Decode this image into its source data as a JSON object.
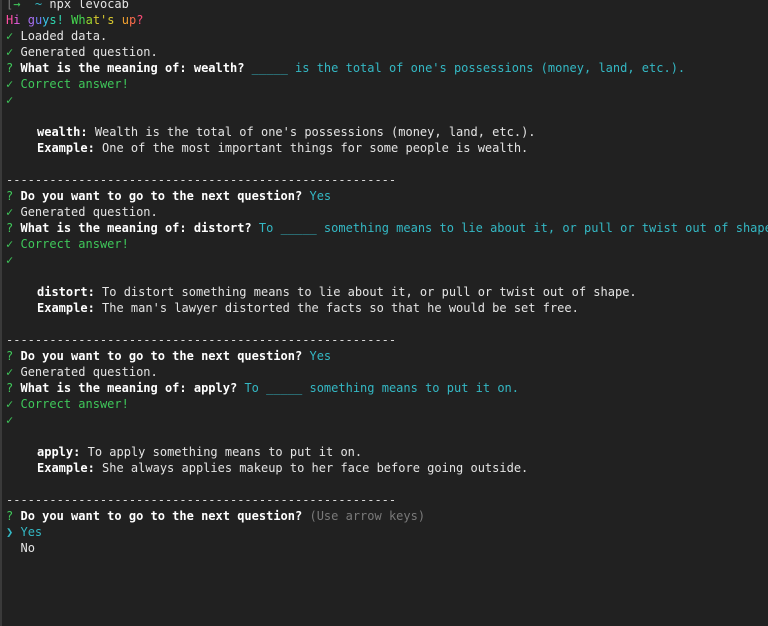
{
  "terminal": {
    "background": "#212121",
    "foreground": "#e4e4e4",
    "accent_green": "#3fc75a",
    "accent_cyan": "#34b8c4",
    "dim_gray": "#7a7a7a",
    "prompt": {
      "bracket": "[",
      "arrow_icon": "→",
      "path": "~",
      "command": "npx levocab"
    },
    "greeting": {
      "text": "Hi guys! What's up?",
      "chars": [
        "H",
        "i",
        " ",
        "g",
        "u",
        "y",
        "s",
        "!",
        " ",
        "W",
        "h",
        "a",
        "t",
        "'",
        "s",
        " ",
        "u",
        "p",
        "?"
      ]
    },
    "status": {
      "check_icon": "✓",
      "question_icon": "?",
      "pointer_icon": "❯",
      "loaded": "Loaded data.",
      "generated": "Generated question.",
      "correct": "Correct answer!",
      "next_prompt": "Do you want to go to the next question?",
      "answer_yes": "Yes",
      "answer_no": "No",
      "hint": "(Use arrow keys)",
      "separator": "------------------------------------------------------"
    },
    "questions": [
      {
        "prompt": "What is the meaning of: wealth?",
        "answer": "_____ is the total of one's possessions (money, land, etc.).",
        "term": "wealth:",
        "definition": "Wealth is the total of one's possessions (money, land, etc.).",
        "example_label": "Example:",
        "example": "One of the most important things for some people is wealth."
      },
      {
        "prompt": "What is the meaning of: distort?",
        "answer": "To _____ something means to lie about it, or pull or twist out of shape.",
        "term": "distort:",
        "definition": "To distort something means to lie about it, or pull or twist out of shape.",
        "example_label": "Example:",
        "example": "The man's lawyer distorted the facts so that he would be set free."
      },
      {
        "prompt": "What is the meaning of: apply?",
        "answer": "To _____ something means to put it on.",
        "term": "apply:",
        "definition": "To apply something means to put it on.",
        "example_label": "Example:",
        "example": "She always applies makeup to her face before going outside."
      }
    ]
  }
}
